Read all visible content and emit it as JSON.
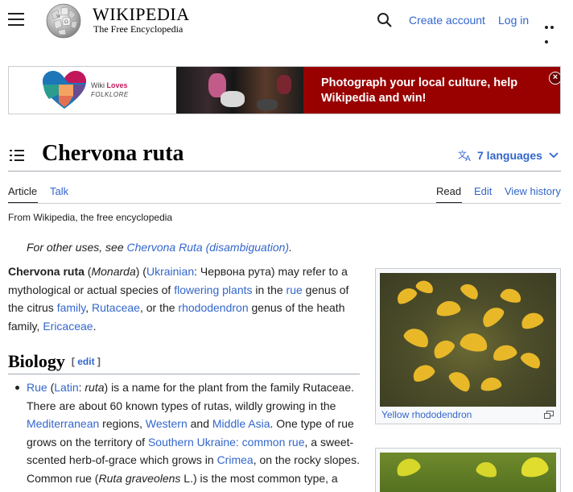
{
  "header": {
    "wordmark": "WIKIPEDIA",
    "tagline": "The Free Encyclopedia",
    "create_account": "Create account",
    "log_in": "Log in"
  },
  "banner": {
    "logo_line1_a": "Wiki ",
    "logo_line1_b": "Loves",
    "logo_line2": "FOLKLORE",
    "message": "Photograph your local culture, help Wikipedia and win!",
    "close_glyph": "×",
    "bg_color": "#990000"
  },
  "article": {
    "title": "Chervona ruta",
    "languages": "7 languages",
    "tabs": {
      "article": "Article",
      "talk": "Talk",
      "read": "Read",
      "edit": "Edit",
      "view_history": "View history"
    },
    "from": "From Wikipedia, the free encyclopedia",
    "hatnote": {
      "prefix": "For other uses, see ",
      "link": "Chervona Ruta (disambiguation)",
      "suffix": "."
    },
    "intro": {
      "t1": "Chervona ruta",
      "t2": " (",
      "t3": "Monarda",
      "t4": ") (",
      "l1": "Ukrainian",
      "t5": ": Червона рута) may refer to a mythological or actual species of ",
      "l2": "flowering plants",
      "t6": " in the ",
      "l3": "rue",
      "t7": " genus of the citrus ",
      "l4": "family",
      "t8": ", ",
      "l5": "Rutaceae",
      "t9": ", or the ",
      "l6": "rhododendron",
      "t10": " genus of the heath family, ",
      "l7": "Ericaceae",
      "t11": "."
    },
    "section": {
      "title": "Biology",
      "edit_open": "[ ",
      "edit": "edit",
      "edit_close": " ]"
    },
    "bullet": {
      "l1": "Rue",
      "t1": " (",
      "l2": "Latin",
      "t2": ": ",
      "t3": "ruta",
      "t4": ") is a name for the plant from the family Rutaceae. There are about 60 known types of rutas, wildly growing in the ",
      "l3": "Mediterranean",
      "t5": " regions, ",
      "l4": "Western",
      "t6": " and ",
      "l5": "Middle Asia",
      "t7": ". One type of rue grows on the territory of ",
      "l6": "Southern Ukraine: common rue",
      "t8": ", a sweet-scented herb-of-grace which grows in ",
      "l7": "Crimea",
      "t9": ", on the rocky slopes. Common rue (",
      "t10": "Ruta graveolens",
      "t11": " L.) is the most common type, a"
    },
    "figure_caption": "Yellow rhododendron"
  },
  "colors": {
    "link": "#3366cc",
    "text": "#202122",
    "border": "#a2a9b1"
  }
}
